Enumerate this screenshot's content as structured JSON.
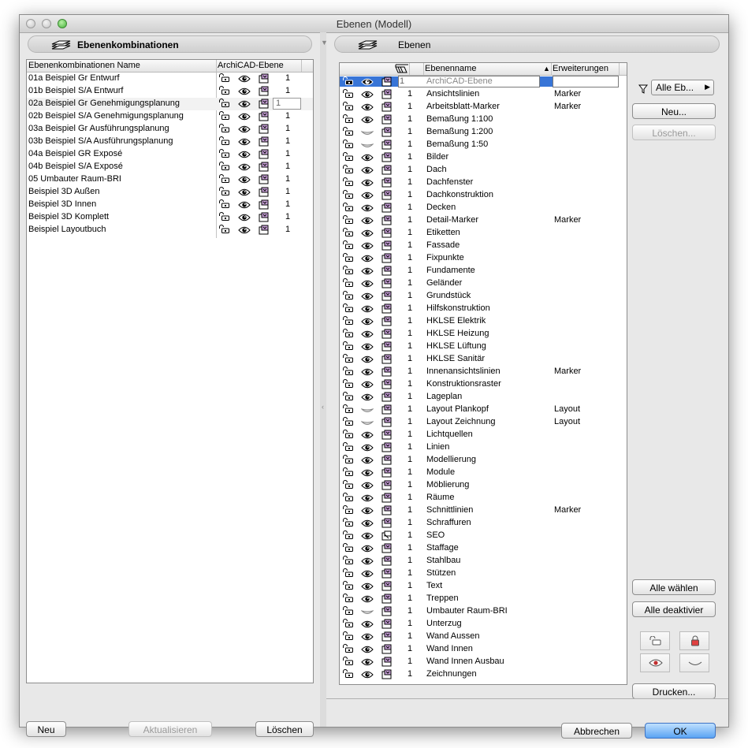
{
  "window": {
    "title": "Ebenen (Modell)"
  },
  "left": {
    "header": "Ebenenkombinationen",
    "columns": {
      "name": "Ebenenkombinationen Name",
      "archicad": "ArchiCAD-Ebene"
    },
    "rows": [
      {
        "name": "01a Beispiel Gr Entwurf",
        "value": "1"
      },
      {
        "name": "01b Beispiel S/A Entwurf",
        "value": "1"
      },
      {
        "name": "02a Beispiel Gr Genehmigungsplanung",
        "value": "1",
        "selected": true
      },
      {
        "name": "02b Beispiel S/A Genehmigungsplanung",
        "value": "1"
      },
      {
        "name": "03a Beispiel Gr Ausführungsplanung",
        "value": "1"
      },
      {
        "name": "03b Beispiel S/A Ausführungsplanung",
        "value": "1"
      },
      {
        "name": "04a Beispiel GR Exposé",
        "value": "1"
      },
      {
        "name": "04b Beispiel S/A Exposé",
        "value": "1"
      },
      {
        "name": "05 Umbauter Raum-BRI",
        "value": "1"
      },
      {
        "name": "Beispiel 3D Außen",
        "value": "1"
      },
      {
        "name": "Beispiel 3D Innen",
        "value": "1"
      },
      {
        "name": "Beispiel 3D Komplett",
        "value": "1"
      },
      {
        "name": "Beispiel Layoutbuch",
        "value": "1"
      }
    ],
    "buttons": {
      "new": "Neu",
      "update": "Aktualisieren",
      "delete": "Löschen"
    }
  },
  "right": {
    "header": "Ebenen",
    "columns": {
      "name": "Ebenenname",
      "ext": "Erweiterungen"
    },
    "rows": [
      {
        "num": "1",
        "name": "ArchiCAD-Ebene",
        "ext": "",
        "vis": "eye",
        "selected": true
      },
      {
        "num": "1",
        "name": "Ansichtslinien",
        "ext": "Marker",
        "vis": "eye"
      },
      {
        "num": "1",
        "name": "Arbeitsblatt-Marker",
        "ext": "Marker",
        "vis": "eye"
      },
      {
        "num": "1",
        "name": "Bemaßung 1:100",
        "ext": "",
        "vis": "eye"
      },
      {
        "num": "1",
        "name": "Bemaßung 1:200",
        "ext": "",
        "vis": "hidden"
      },
      {
        "num": "1",
        "name": "Bemaßung 1:50",
        "ext": "",
        "vis": "hidden"
      },
      {
        "num": "1",
        "name": "Bilder",
        "ext": "",
        "vis": "eye"
      },
      {
        "num": "1",
        "name": "Dach",
        "ext": "",
        "vis": "eye"
      },
      {
        "num": "1",
        "name": "Dachfenster",
        "ext": "",
        "vis": "eye"
      },
      {
        "num": "1",
        "name": "Dachkonstruktion",
        "ext": "",
        "vis": "eye"
      },
      {
        "num": "1",
        "name": "Decken",
        "ext": "",
        "vis": "eye"
      },
      {
        "num": "1",
        "name": "Detail-Marker",
        "ext": "Marker",
        "vis": "eye"
      },
      {
        "num": "1",
        "name": "Etiketten",
        "ext": "",
        "vis": "eye"
      },
      {
        "num": "1",
        "name": "Fassade",
        "ext": "",
        "vis": "eye"
      },
      {
        "num": "1",
        "name": "Fixpunkte",
        "ext": "",
        "vis": "eye"
      },
      {
        "num": "1",
        "name": "Fundamente",
        "ext": "",
        "vis": "eye"
      },
      {
        "num": "1",
        "name": "Geländer",
        "ext": "",
        "vis": "eye"
      },
      {
        "num": "1",
        "name": "Grundstück",
        "ext": "",
        "vis": "eye"
      },
      {
        "num": "1",
        "name": "Hilfskonstruktion",
        "ext": "",
        "vis": "eye"
      },
      {
        "num": "1",
        "name": "HKLSE Elektrik",
        "ext": "",
        "vis": "eye"
      },
      {
        "num": "1",
        "name": "HKLSE Heizung",
        "ext": "",
        "vis": "eye"
      },
      {
        "num": "1",
        "name": "HKLSE Lüftung",
        "ext": "",
        "vis": "eye"
      },
      {
        "num": "1",
        "name": "HKLSE Sanitär",
        "ext": "",
        "vis": "eye"
      },
      {
        "num": "1",
        "name": "Innenansichtslinien",
        "ext": "Marker",
        "vis": "eye"
      },
      {
        "num": "1",
        "name": "Konstruktionsraster",
        "ext": "",
        "vis": "eye"
      },
      {
        "num": "1",
        "name": "Lageplan",
        "ext": "",
        "vis": "eye"
      },
      {
        "num": "1",
        "name": "Layout Plankopf",
        "ext": "Layout",
        "vis": "hidden"
      },
      {
        "num": "1",
        "name": "Layout Zeichnung",
        "ext": "Layout",
        "vis": "hidden"
      },
      {
        "num": "1",
        "name": "Lichtquellen",
        "ext": "",
        "vis": "eye"
      },
      {
        "num": "1",
        "name": "Linien",
        "ext": "",
        "vis": "eye"
      },
      {
        "num": "1",
        "name": "Modellierung",
        "ext": "",
        "vis": "eye"
      },
      {
        "num": "1",
        "name": "Module",
        "ext": "",
        "vis": "eye"
      },
      {
        "num": "1",
        "name": "Möblierung",
        "ext": "",
        "vis": "eye"
      },
      {
        "num": "1",
        "name": "Räume",
        "ext": "",
        "vis": "eye"
      },
      {
        "num": "1",
        "name": "Schnittlinien",
        "ext": "Marker",
        "vis": "eye"
      },
      {
        "num": "1",
        "name": "Schraffuren",
        "ext": "",
        "vis": "eye"
      },
      {
        "num": "1",
        "name": "SEO",
        "ext": "",
        "vis": "eye"
      },
      {
        "num": "1",
        "name": "Staffage",
        "ext": "",
        "vis": "eye"
      },
      {
        "num": "1",
        "name": "Stahlbau",
        "ext": "",
        "vis": "eye"
      },
      {
        "num": "1",
        "name": "Stützen",
        "ext": "",
        "vis": "eye"
      },
      {
        "num": "1",
        "name": "Text",
        "ext": "",
        "vis": "eye"
      },
      {
        "num": "1",
        "name": "Treppen",
        "ext": "",
        "vis": "eye"
      },
      {
        "num": "1",
        "name": "Umbauter Raum-BRI",
        "ext": "",
        "vis": "hidden"
      },
      {
        "num": "1",
        "name": "Unterzug",
        "ext": "",
        "vis": "eye"
      },
      {
        "num": "1",
        "name": "Wand Aussen",
        "ext": "",
        "vis": "eye"
      },
      {
        "num": "1",
        "name": "Wand Innen",
        "ext": "",
        "vis": "eye"
      },
      {
        "num": "1",
        "name": "Wand Innen Ausbau",
        "ext": "",
        "vis": "eye"
      },
      {
        "num": "1",
        "name": "Zeichnungen",
        "ext": "",
        "vis": "eye"
      }
    ],
    "filter": {
      "selected": "Alle Eb..."
    },
    "buttons": {
      "new": "Neu...",
      "delete": "Löschen...",
      "select_all": "Alle wählen",
      "deselect_all": "Alle deaktivier",
      "print": "Drucken...",
      "cancel": "Abbrechen",
      "ok": "OK"
    }
  },
  "colors": {
    "accent": "#3875d7",
    "window_bg": "#e8e8e8"
  }
}
